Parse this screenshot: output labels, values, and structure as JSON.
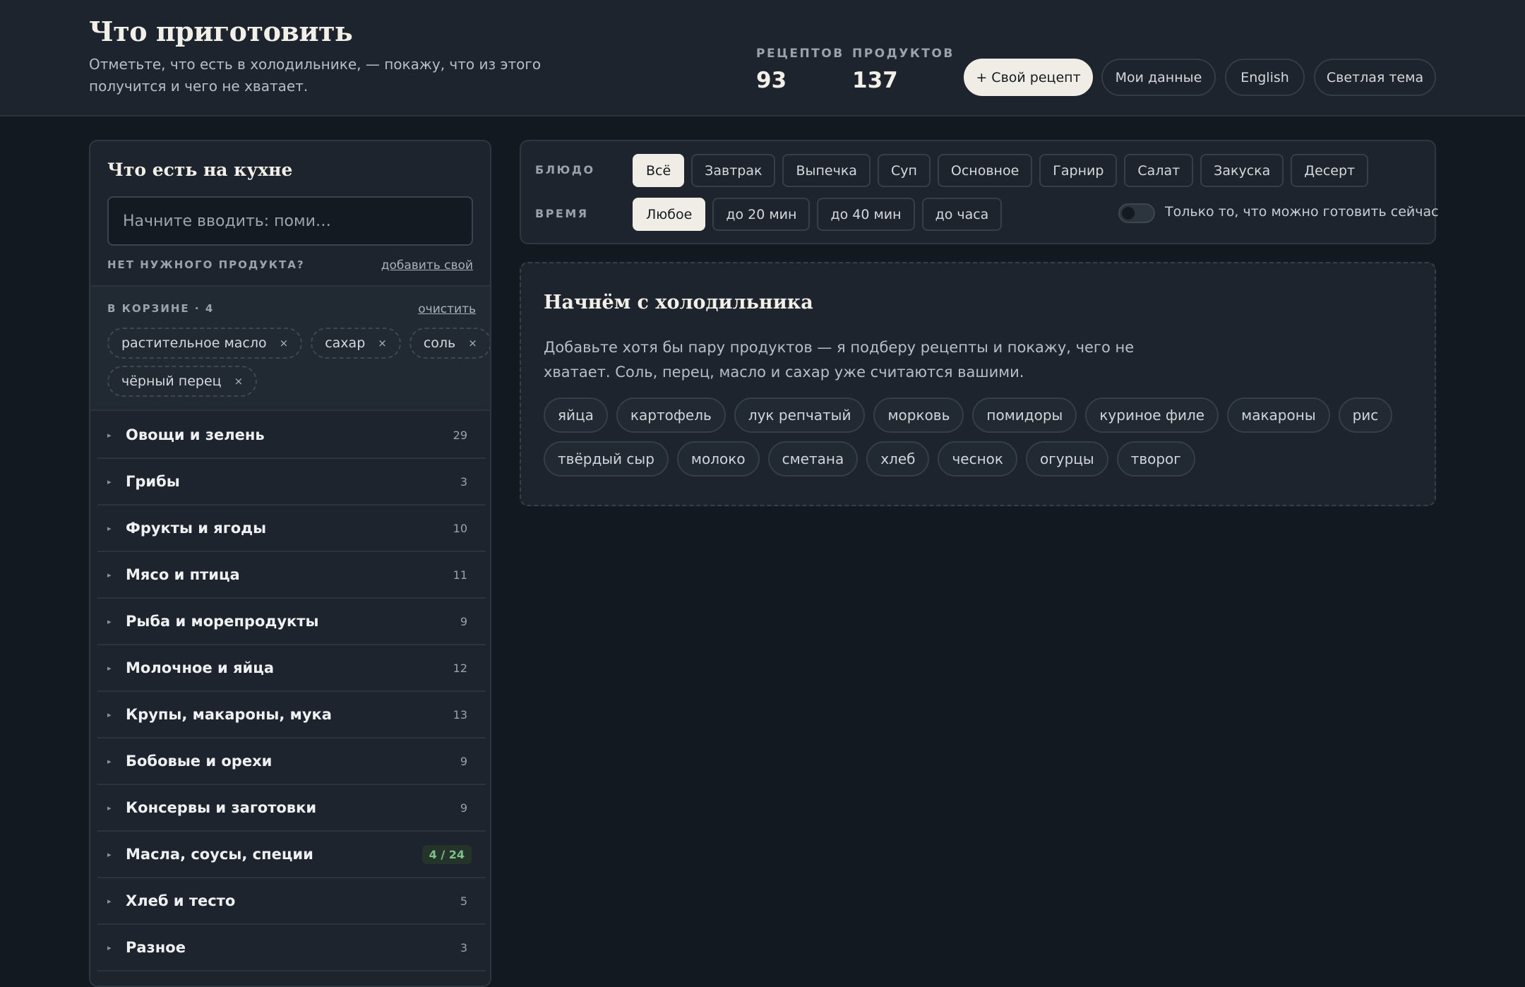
{
  "header": {
    "title": "Что приготовить",
    "subtitle": "Отметьте, что есть в холодильнике, — покажу, что из этого получится и чего не хватает.",
    "stats": [
      {
        "label": "РЕЦЕПТОВ",
        "value": "93"
      },
      {
        "label": "ПРОДУКТОВ",
        "value": "137"
      }
    ],
    "buttons": {
      "add_recipe": "+ Свой рецепт",
      "my_data": "Мои данные",
      "language": "English",
      "theme": "Светлая тема"
    }
  },
  "sidebar": {
    "title": "Что есть на кухне",
    "search_placeholder": "Начните вводить: поми…",
    "missing_label": "НЕТ НУЖНОГО ПРОДУКТА?",
    "add_own": "добавить свой",
    "basket": {
      "label": "В КОРЗИНЕ · 4",
      "clear": "очистить",
      "items": [
        "растительное масло",
        "сахар",
        "соль",
        "чёрный перец"
      ],
      "remove_glyph": "×"
    },
    "categories": [
      {
        "name": "Овощи и зелень",
        "count": "29"
      },
      {
        "name": "Грибы",
        "count": "3"
      },
      {
        "name": "Фрукты и ягоды",
        "count": "10"
      },
      {
        "name": "Мясо и птица",
        "count": "11"
      },
      {
        "name": "Рыба и морепродукты",
        "count": "9"
      },
      {
        "name": "Молочное и яйца",
        "count": "12"
      },
      {
        "name": "Крупы, макароны, мука",
        "count": "13"
      },
      {
        "name": "Бобовые и орехи",
        "count": "9"
      },
      {
        "name": "Консервы и заготовки",
        "count": "9"
      },
      {
        "name": "Масла, соусы, специи",
        "count": "4 / 24"
      },
      {
        "name": "Хлеб и тесто",
        "count": "5"
      },
      {
        "name": "Разное",
        "count": "3"
      }
    ]
  },
  "filters": {
    "dish_label": "БЛЮДО",
    "dish_options": [
      "Всё",
      "Завтрак",
      "Выпечка",
      "Суп",
      "Основное",
      "Гарнир",
      "Салат",
      "Закуска",
      "Десерт"
    ],
    "dish_selected": "Всё",
    "time_label": "ВРЕМЯ",
    "time_options": [
      "Любое",
      "до 20 мин",
      "до 40 мин",
      "до часа"
    ],
    "time_selected": "Любое",
    "only_now_label": "Только то, что можно готовить сейчас"
  },
  "empty_state": {
    "title": "Начнём с холодильника",
    "text": "Добавьте хотя бы пару продуктов — я подберу рецепты и покажу, чего не хватает. Соль, перец, масло и сахар уже считаются вашими.",
    "suggestions": [
      "яйца",
      "картофель",
      "лук репчатый",
      "морковь",
      "помидоры",
      "куриное филе",
      "макароны",
      "рис",
      "твёрдый сыр",
      "молоко",
      "сметана",
      "хлеб",
      "чеснок",
      "огурцы",
      "творог"
    ]
  }
}
